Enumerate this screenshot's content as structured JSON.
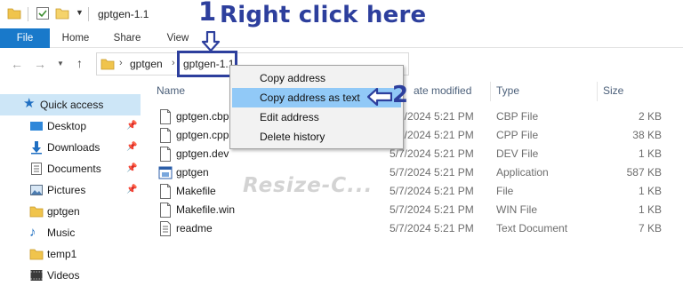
{
  "window": {
    "title": "gptgen-1.1"
  },
  "ribbon": {
    "tabs": [
      "File",
      "Home",
      "Share",
      "View"
    ]
  },
  "address": {
    "crumbs": [
      "gptgen",
      "gptgen-1.1"
    ]
  },
  "annotations": {
    "step1_number": "1",
    "step1_text": "Right click here",
    "step2_number": "2"
  },
  "context_menu": {
    "items": [
      "Copy address",
      "Copy address as text",
      "Edit address",
      "Delete history"
    ],
    "highlighted_index": 1
  },
  "sidebar": {
    "quick_access": "Quick access",
    "items": [
      {
        "label": "Desktop",
        "icon": "desktop-icon",
        "pinned": true
      },
      {
        "label": "Downloads",
        "icon": "downloads-icon",
        "pinned": true
      },
      {
        "label": "Documents",
        "icon": "documents-icon",
        "pinned": true
      },
      {
        "label": "Pictures",
        "icon": "pictures-icon",
        "pinned": true
      },
      {
        "label": "gptgen",
        "icon": "folder-icon",
        "pinned": false
      },
      {
        "label": "Music",
        "icon": "music-icon",
        "pinned": false
      },
      {
        "label": "temp1",
        "icon": "folder-icon",
        "pinned": false
      },
      {
        "label": "Videos",
        "icon": "videos-icon",
        "pinned": false
      }
    ]
  },
  "file_list": {
    "columns": {
      "name": "Name",
      "date_modified": "ate modified",
      "type": "Type",
      "size": "Size"
    },
    "rows": [
      {
        "name": "gptgen.cbp",
        "date": "5/7/2024 5:21 PM",
        "type": "CBP File",
        "size": "2 KB",
        "icon": "file-icon"
      },
      {
        "name": "gptgen.cpp",
        "date": "5/7/2024 5:21 PM",
        "type": "CPP File",
        "size": "38 KB",
        "icon": "file-icon"
      },
      {
        "name": "gptgen.dev",
        "date": "5/7/2024 5:21 PM",
        "type": "DEV File",
        "size": "1 KB",
        "icon": "file-icon"
      },
      {
        "name": "gptgen",
        "date": "5/7/2024 5:21 PM",
        "type": "Application",
        "size": "587 KB",
        "icon": "application-icon"
      },
      {
        "name": "Makefile",
        "date": "5/7/2024 5:21 PM",
        "type": "File",
        "size": "1 KB",
        "icon": "file-icon"
      },
      {
        "name": "Makefile.win",
        "date": "5/7/2024 5:21 PM",
        "type": "WIN File",
        "size": "1 KB",
        "icon": "file-icon"
      },
      {
        "name": "readme",
        "date": "5/7/2024 5:21 PM",
        "type": "Text Document",
        "size": "7 KB",
        "icon": "text-document-icon"
      }
    ]
  },
  "watermark": "Resize-C...",
  "colors": {
    "accent": "#1979ca",
    "annotation": "#2d3f9d",
    "menu_highlight": "#91c9f7",
    "selection": "#cde6f7"
  }
}
